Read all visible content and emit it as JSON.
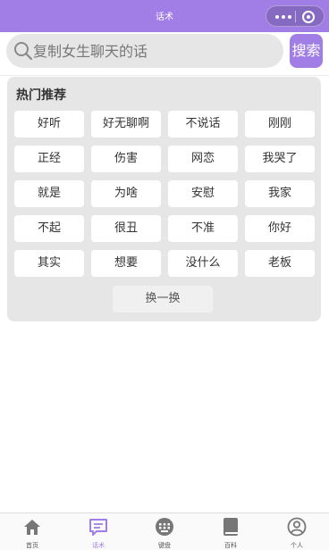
{
  "window": {
    "title": "话术"
  },
  "search": {
    "placeholder": "复制女生聊天的话",
    "button_label": "搜索"
  },
  "hot": {
    "title": "热门推荐",
    "tags": [
      "好听",
      "好无聊啊",
      "不说话",
      "刚刚",
      "正经",
      "伤害",
      "网恋",
      "我哭了",
      "就是",
      "为啥",
      "安慰",
      "我家",
      "不起",
      "很丑",
      "不准",
      "你好",
      "其实",
      "想要",
      "没什么",
      "老板"
    ],
    "refresh_label": "换一换"
  },
  "tabbar": {
    "items": [
      {
        "label": "首页",
        "icon": "home-icon"
      },
      {
        "label": "话术",
        "icon": "chat-icon",
        "active": true
      },
      {
        "label": "键盘",
        "icon": "keyboard-icon"
      },
      {
        "label": "百科",
        "icon": "book-icon"
      },
      {
        "label": "个人",
        "icon": "user-icon"
      }
    ]
  },
  "colors": {
    "accent": "#a07ee6",
    "panel": "#e6e6e6",
    "icon_gray": "#777777"
  }
}
